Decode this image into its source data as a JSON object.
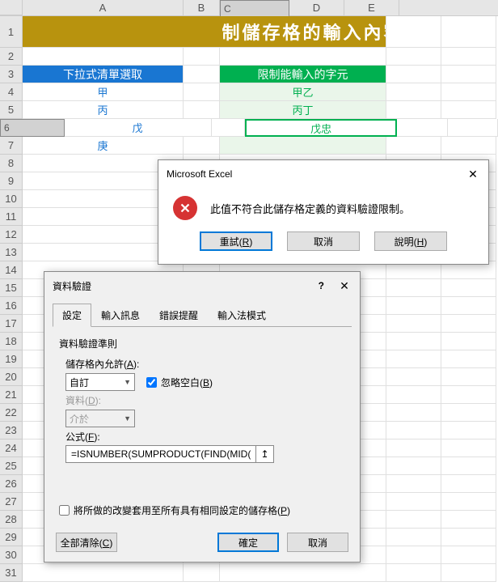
{
  "cols": [
    "A",
    "B",
    "C",
    "D",
    "E"
  ],
  "banner": "限制儲存格的輸入內容",
  "headers": {
    "dropdown": "下拉式清單選取",
    "restrict": "限制能輸入的字元"
  },
  "colA": [
    "甲",
    "丙",
    "戊",
    "庚"
  ],
  "colC": [
    "甲乙",
    "丙丁",
    "戊忠"
  ],
  "msg": {
    "title": "Microsoft Excel",
    "text": "此值不符合此儲存格定義的資料驗證限制。",
    "retry": "重試(R)",
    "cancel": "取消",
    "help": "說明(H)"
  },
  "dlg": {
    "title": "資料驗證",
    "tabs": [
      "設定",
      "輸入訊息",
      "錯誤提醒",
      "輸入法模式"
    ],
    "criteria": "資料驗證準則",
    "allow_lbl": "儲存格內允許(A):",
    "allow_val": "自訂",
    "ignore_blank": "忽略空白(B)",
    "data_lbl": "資料(D):",
    "data_val": "介於",
    "formula_lbl": "公式(F):",
    "formula_val": "=ISNUMBER(SUMPRODUCT(FIND(MID(",
    "apply": "將所做的改變套用至所有具有相同設定的儲存格(P)",
    "clear": "全部清除(C)",
    "ok": "確定",
    "cancel": "取消"
  }
}
